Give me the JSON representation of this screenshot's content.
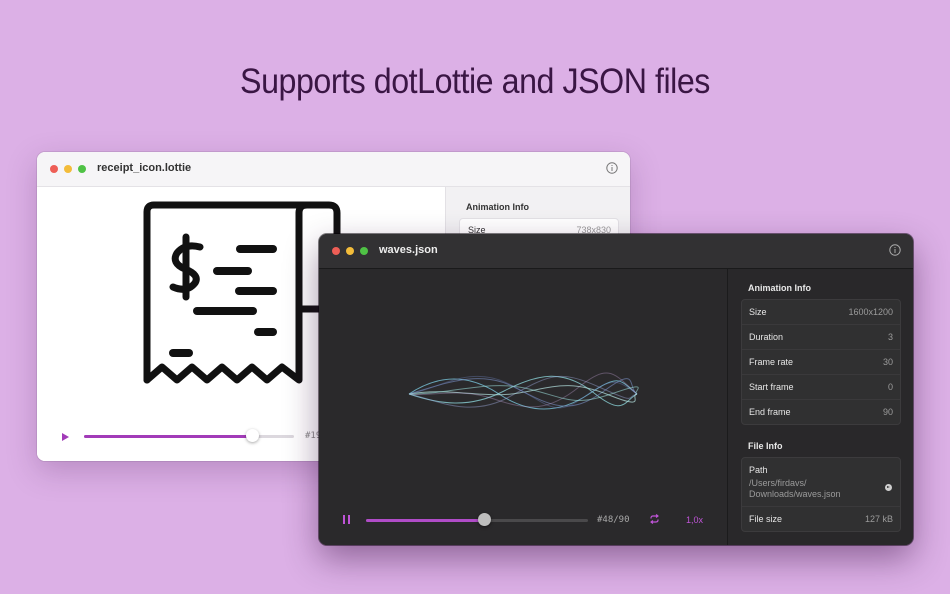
{
  "headline": "Supports dotLottie and JSON files",
  "colors": {
    "accent": "#a23bb8",
    "background": "#dcb0e6"
  },
  "light_window": {
    "title": "receipt_icon.lottie",
    "info_icon": "info-circle-icon",
    "sidebar": {
      "section_title": "Animation Info",
      "rows": [
        {
          "label": "Size",
          "value": "738x830"
        }
      ]
    },
    "controls": {
      "play_icon": "play-icon",
      "frame": "#19",
      "progress": 0.8
    }
  },
  "dark_window": {
    "title": "waves.json",
    "info_icon": "info-circle-icon",
    "animation_info": {
      "section_title": "Animation Info",
      "rows": [
        {
          "label": "Size",
          "value": "1600x1200"
        },
        {
          "label": "Duration",
          "value": "3"
        },
        {
          "label": "Frame rate",
          "value": "30"
        },
        {
          "label": "Start frame",
          "value": "0"
        },
        {
          "label": "End frame",
          "value": "90"
        }
      ]
    },
    "file_info": {
      "section_title": "File Info",
      "path_label": "Path",
      "path_value": "/Users/firdavs/ Downloads/waves.json",
      "size_label": "File size",
      "size_value": "127 kB"
    },
    "controls": {
      "pause_icon": "pause-icon",
      "frame": "#48/90",
      "progress": 0.533,
      "loop_icon": "loop-icon",
      "speed": "1,0x"
    }
  }
}
